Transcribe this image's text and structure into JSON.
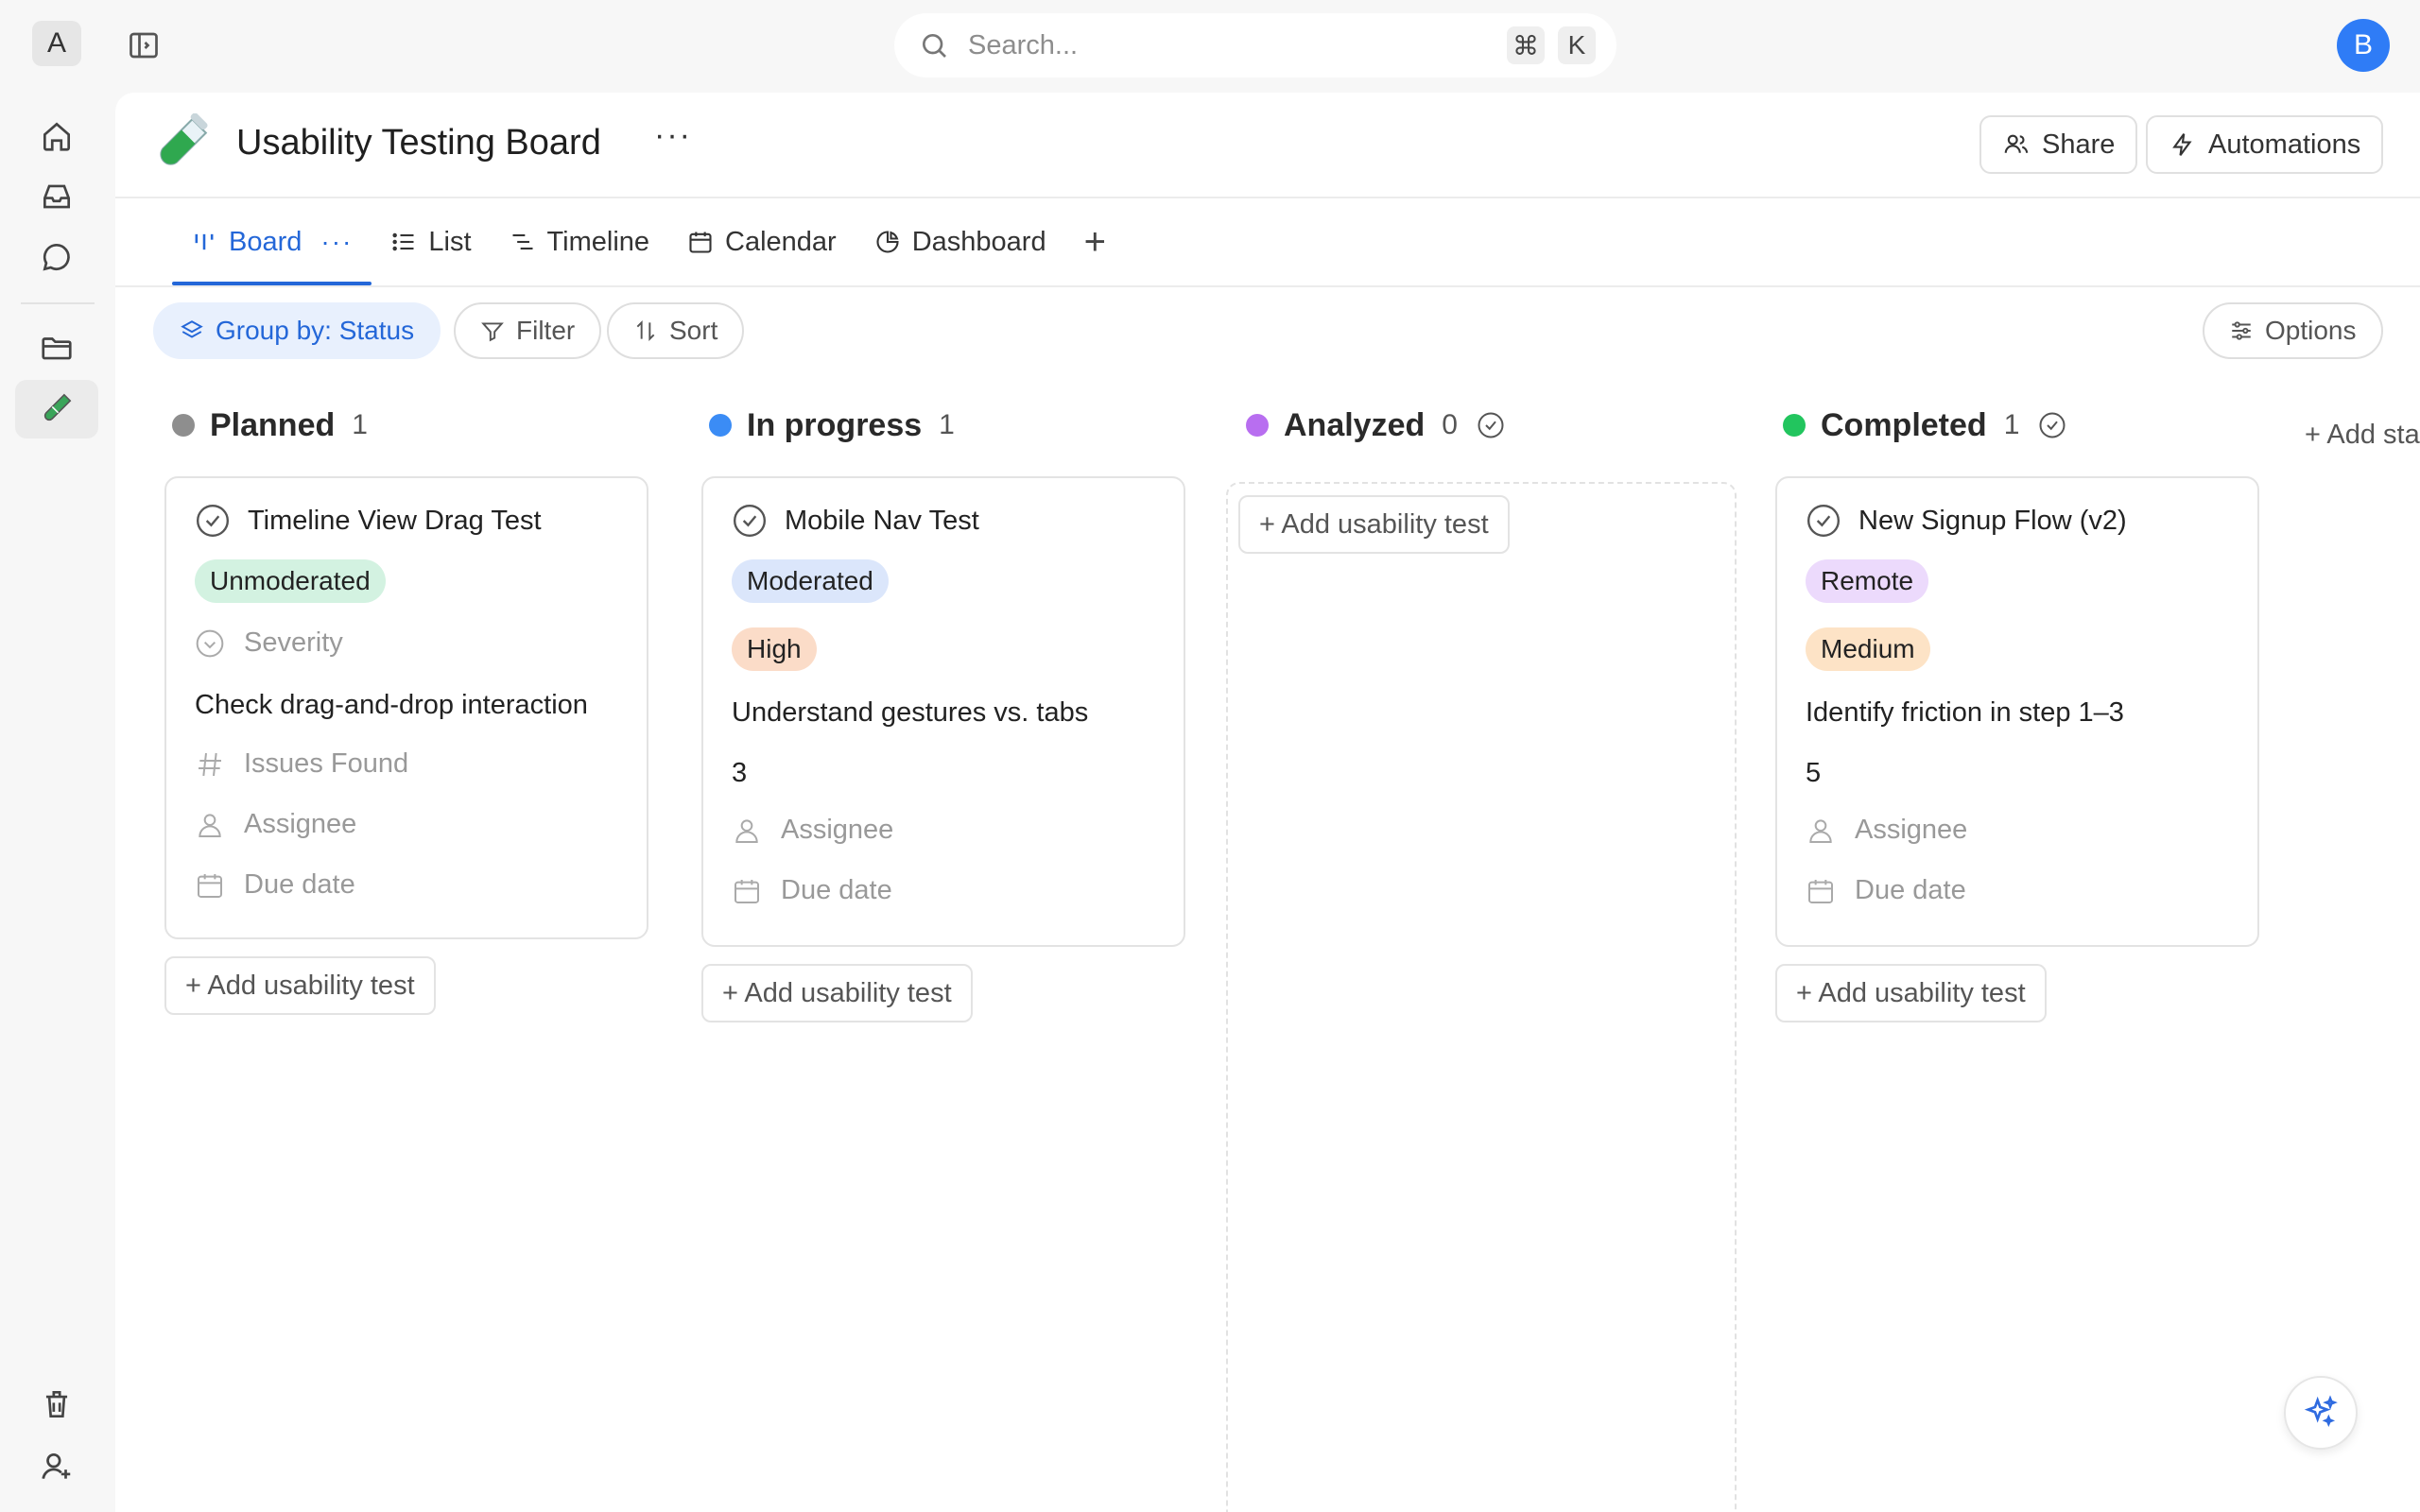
{
  "workspace": {
    "initial": "A"
  },
  "search": {
    "placeholder": "Search...",
    "shortcut": [
      "⌘",
      "K"
    ]
  },
  "user": {
    "initial": "B"
  },
  "rail": {
    "top_items": [
      "home-icon",
      "inbox-icon",
      "chat-icon"
    ],
    "bottom_items": [
      "folder-icon",
      "test-tube-icon"
    ],
    "footer_items": [
      "trash-icon",
      "add-user-icon"
    ]
  },
  "board": {
    "title": "Usability Testing Board",
    "more": "···",
    "share_label": "Share",
    "automations_label": "Automations"
  },
  "tabs": [
    {
      "label": "Board",
      "icon": "board-icon",
      "active": true
    },
    {
      "label": "List",
      "icon": "list-icon"
    },
    {
      "label": "Timeline",
      "icon": "timeline-icon"
    },
    {
      "label": "Calendar",
      "icon": "calendar-icon"
    },
    {
      "label": "Dashboard",
      "icon": "dashboard-icon"
    }
  ],
  "tab_more": "···",
  "tab_add": "+",
  "toolbar": {
    "group_by": "Group by: Status",
    "filter": "Filter",
    "sort": "Sort",
    "options": "Options"
  },
  "columns": [
    {
      "name": "Planned",
      "count": "1",
      "color": "#8e8e8e"
    },
    {
      "name": "In progress",
      "count": "1",
      "color": "#3b8cf5"
    },
    {
      "name": "Analyzed",
      "count": "0",
      "color": "#b86ef0"
    },
    {
      "name": "Completed",
      "count": "1",
      "color": "#22c55e"
    }
  ],
  "add_status": "+ Add status",
  "add_card_label": "+ Add usability test",
  "cards": {
    "planned": {
      "title": "Timeline View Drag Test",
      "tag": "Unmoderated",
      "tag_color": "#d3f2e1",
      "severity_placeholder": "Severity",
      "description": "Check drag-and-drop interaction",
      "issues_placeholder": "Issues Found",
      "assignee_placeholder": "Assignee",
      "due_placeholder": "Due date"
    },
    "in_progress": {
      "title": "Mobile Nav Test",
      "tag": "Moderated",
      "tag_color": "#dbe6fb",
      "severity": "High",
      "severity_color": "#fbdcc8",
      "description": "Understand gestures vs. tabs",
      "issues": "3",
      "assignee_placeholder": "Assignee",
      "due_placeholder": "Due date"
    },
    "completed": {
      "title": "New Signup Flow (v2)",
      "tag": "Remote",
      "tag_color": "#ecdafc",
      "severity": "Medium",
      "severity_color": "#fde3c6",
      "description": "Identify friction in step 1–3",
      "issues": "5",
      "assignee_placeholder": "Assignee",
      "due_placeholder": "Due date"
    }
  }
}
